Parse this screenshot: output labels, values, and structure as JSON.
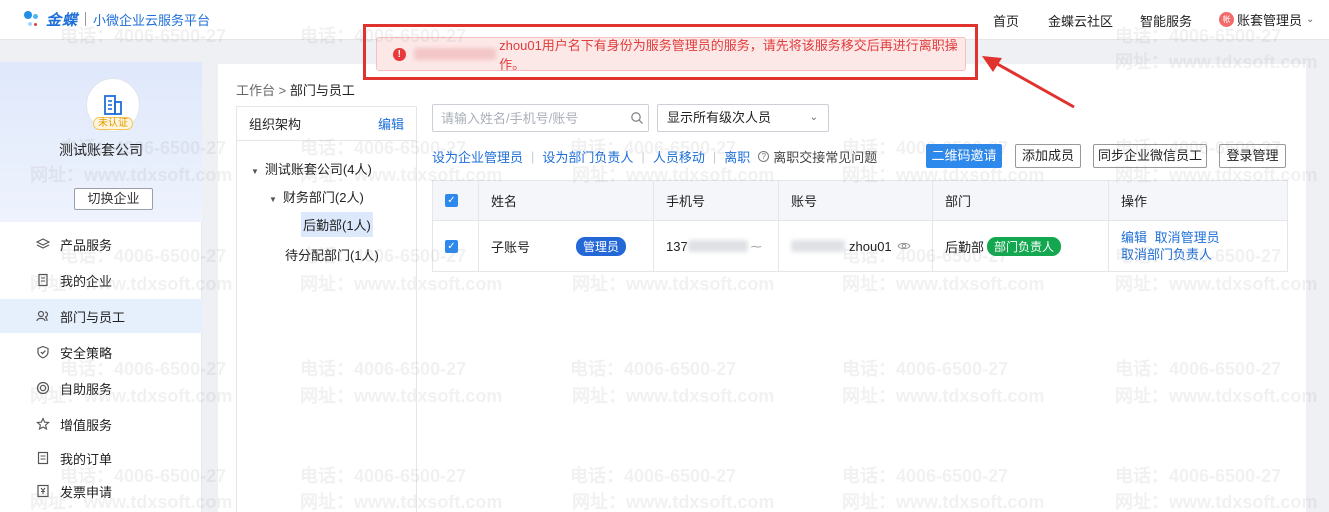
{
  "header": {
    "brand": "金蝶",
    "platform": "小微企业云服务平台",
    "nav": [
      "首页",
      "金蝶云社区",
      "智能服务"
    ],
    "user": {
      "avatar_text": "帐",
      "label": "账套管理员"
    }
  },
  "sidebar": {
    "verify_badge": "未认证",
    "company_name": "测试账套公司",
    "switch_label": "切换企业",
    "items": [
      {
        "label": "产品服务",
        "icon": "layers-icon"
      },
      {
        "label": "我的企业",
        "icon": "building-icon"
      },
      {
        "label": "部门与员工",
        "icon": "people-icon",
        "active": true
      },
      {
        "label": "安全策略",
        "icon": "shield-icon"
      },
      {
        "label": "自助服务",
        "icon": "target-icon"
      },
      {
        "label": "增值服务",
        "icon": "star-icon"
      },
      {
        "label": "我的订单",
        "icon": "document-icon"
      },
      {
        "label": "发票申请",
        "icon": "invoice-icon"
      }
    ]
  },
  "breadcrumb": {
    "root": "工作台",
    "separator": ">",
    "current": "部门与员工"
  },
  "org": {
    "title": "组织架构",
    "edit_label": "编辑",
    "tree": {
      "root": "测试账套公司(4人)",
      "finance": "财务部门(2人)",
      "logistics": "后勤部(1人)",
      "unassigned": "待分配部门(1人)"
    }
  },
  "toolbar": {
    "search_placeholder": "请输入姓名/手机号/账号",
    "level_select": "显示所有级次人员",
    "links": [
      "设为企业管理员",
      "设为部门负责人",
      "人员移动",
      "离职"
    ],
    "faq_label": "离职交接常见问题",
    "buttons": {
      "qr_invite": "二维码邀请",
      "add_member": "添加成员",
      "sync_wechat": "同步企业微信员工",
      "login_mgmt": "登录管理"
    }
  },
  "table": {
    "columns": [
      "姓名",
      "手机号",
      "账号",
      "部门",
      "操作"
    ],
    "rows": [
      {
        "name": "子账号",
        "role_tag": "管理员",
        "phone": "137",
        "account": "zhou01",
        "department": "后勤部",
        "dept_tag": "部门负责人",
        "ops": [
          "编辑",
          "取消管理员",
          "取消部门负责人"
        ]
      }
    ]
  },
  "alert": {
    "message": "zhou01用户名下有身份为服务管理员的服务，请先将该服务移交后再进行离职操作。"
  },
  "watermark": {
    "phone": "电话：4006-6500-27",
    "site": "网址：www.tdxsoft.com"
  },
  "colors": {
    "accent": "#2e89ec",
    "link": "#1e6fd9",
    "alert_text": "#e03c3c",
    "annotation": "#e0322e",
    "success": "#13a84f"
  }
}
